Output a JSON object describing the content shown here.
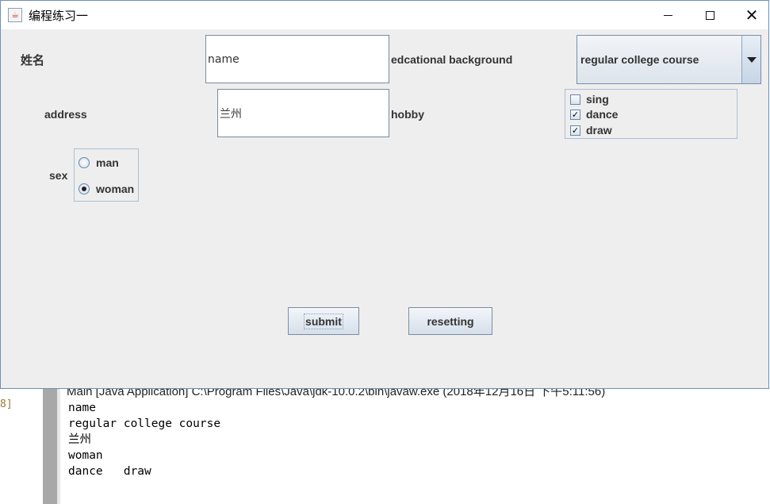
{
  "window": {
    "title": "编程练习一",
    "icon": "java-cup-icon",
    "controls": [
      "minimize-icon",
      "maximize-icon",
      "close-icon"
    ]
  },
  "form": {
    "name_label": "姓名",
    "name_value": "name",
    "education_label": "edcational background",
    "education_value": "regular college course",
    "address_label": "address",
    "address_value": "兰州",
    "hobby_label": "hobby",
    "hobbies": [
      {
        "label": "sing",
        "checked": false
      },
      {
        "label": "dance",
        "checked": true
      },
      {
        "label": "draw",
        "checked": true
      }
    ],
    "sex_label": "sex",
    "sex_options": [
      {
        "label": "man",
        "selected": false
      },
      {
        "label": "woman",
        "selected": true
      }
    ],
    "submit_label": "submit",
    "reset_label": "resetting"
  },
  "console": {
    "header": "Main [Java Application] C:\\Program Files\\Java\\jdk-10.0.2\\bin\\javaw.exe (2018年12月16日 下午5:11:56)",
    "line_marker": "8]",
    "output_lines": [
      "name",
      "regular college course",
      "兰州",
      "woman",
      "dance   draw"
    ]
  },
  "colors": {
    "window_bg": "#eeeeee",
    "border": "#6f8fb3"
  }
}
